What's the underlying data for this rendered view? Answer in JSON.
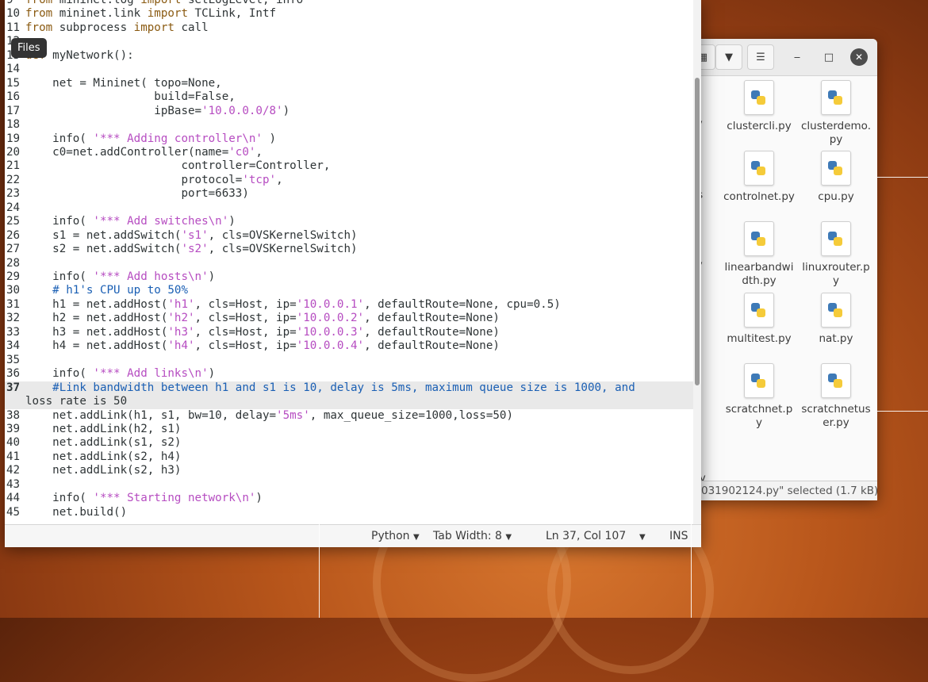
{
  "tooltip": "Files",
  "editor": {
    "lines": [
      {
        "n": "9",
        "t": "from mininet.log import setLogLevel, info"
      },
      {
        "n": "10",
        "t": "from mininet.link import TCLink, Intf"
      },
      {
        "n": "11",
        "t": "from subprocess import call"
      },
      {
        "n": "12",
        "t": ""
      },
      {
        "n": "13",
        "t": "def myNetwork():"
      },
      {
        "n": "14",
        "t": ""
      },
      {
        "n": "15",
        "t": "    net = Mininet( topo=None,"
      },
      {
        "n": "16",
        "t": "                   build=False,"
      },
      {
        "n": "17",
        "t": "                   ipBase='10.0.0.0/8')"
      },
      {
        "n": "18",
        "t": ""
      },
      {
        "n": "19",
        "t": "    info( '*** Adding controller\\n' )"
      },
      {
        "n": "20",
        "t": "    c0=net.addController(name='c0',"
      },
      {
        "n": "21",
        "t": "                       controller=Controller,"
      },
      {
        "n": "22",
        "t": "                       protocol='tcp',"
      },
      {
        "n": "23",
        "t": "                       port=6633)"
      },
      {
        "n": "24",
        "t": ""
      },
      {
        "n": "25",
        "t": "    info( '*** Add switches\\n')"
      },
      {
        "n": "26",
        "t": "    s1 = net.addSwitch('s1', cls=OVSKernelSwitch)"
      },
      {
        "n": "27",
        "t": "    s2 = net.addSwitch('s2', cls=OVSKernelSwitch)"
      },
      {
        "n": "28",
        "t": ""
      },
      {
        "n": "29",
        "t": "    info( '*** Add hosts\\n')"
      },
      {
        "n": "30",
        "t": "    # h1's CPU up to 50%"
      },
      {
        "n": "31",
        "t": "    h1 = net.addHost('h1', cls=Host, ip='10.0.0.1', defaultRoute=None, cpu=0.5)"
      },
      {
        "n": "32",
        "t": "    h2 = net.addHost('h2', cls=Host, ip='10.0.0.2', defaultRoute=None)"
      },
      {
        "n": "33",
        "t": "    h3 = net.addHost('h3', cls=Host, ip='10.0.0.3', defaultRoute=None)"
      },
      {
        "n": "34",
        "t": "    h4 = net.addHost('h4', cls=Host, ip='10.0.0.4', defaultRoute=None)"
      },
      {
        "n": "35",
        "t": ""
      },
      {
        "n": "36",
        "t": "    info( '*** Add links\\n')"
      },
      {
        "n": "37",
        "t": "    #Link bandwidth between h1 and s1 is 10, delay is 5ms, maximum queue size is 1000, and"
      },
      {
        "n": "",
        "t": "loss rate is 50"
      },
      {
        "n": "38",
        "t": "    net.addLink(h1, s1, bw=10, delay='5ms', max_queue_size=1000,loss=50)"
      },
      {
        "n": "39",
        "t": "    net.addLink(h2, s1)"
      },
      {
        "n": "40",
        "t": "    net.addLink(s1, s2)"
      },
      {
        "n": "41",
        "t": "    net.addLink(s2, h4)"
      },
      {
        "n": "42",
        "t": "    net.addLink(s2, h3)"
      },
      {
        "n": "43",
        "t": ""
      },
      {
        "n": "44",
        "t": "    info( '*** Starting network\\n')"
      },
      {
        "n": "45",
        "t": "    net.build()"
      }
    ],
    "current_line": "37",
    "status": {
      "language": "Python",
      "tab_width": "Tab Width: 8",
      "position": "Ln 37, Col 107",
      "mode": "INS"
    }
  },
  "file_manager": {
    "files": [
      "clustercli.py",
      "clusterdemo.py",
      "controlnet.py",
      "cpu.py",
      "linearbandwidth.py",
      "linuxrouter.py",
      "multitest.py",
      "nat.py",
      "scratchnet.py",
      "scratchnetuser.py"
    ],
    "left_fragments": [
      "y",
      "rs",
      "y",
      "l.",
      "",
      "ov"
    ],
    "status": "031902124.py\" selected  (1.7 kB)"
  },
  "colors": {
    "keyword": "#8a5a11",
    "string": "#b64cc1",
    "comment": "#1a5fb4"
  }
}
